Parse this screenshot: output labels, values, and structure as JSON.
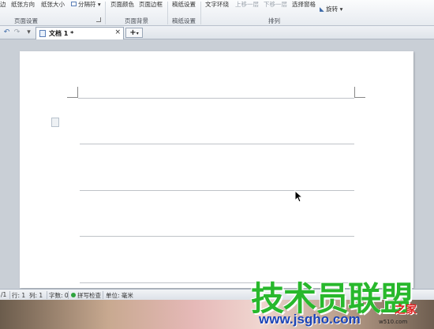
{
  "ribbon": {
    "items": [
      {
        "label": "边",
        "dim": false
      },
      {
        "label": "纸张方向",
        "dim": false
      },
      {
        "label": "纸张大小",
        "dim": false
      },
      {
        "label": "分隔符",
        "dim": false
      },
      {
        "label": "页面颜色",
        "dim": false
      },
      {
        "label": "页面边框",
        "dim": false
      },
      {
        "label": "稿纸设置",
        "dim": false
      },
      {
        "label": "文字环绕",
        "dim": false
      },
      {
        "label": "上移一层",
        "dim": true
      },
      {
        "label": "下移一层",
        "dim": true
      },
      {
        "label": "选择窗格",
        "dim": false
      },
      {
        "label": "旋转",
        "dim": false
      }
    ],
    "groups": [
      "页面设置",
      "页面背景",
      "稿纸设置",
      "排列"
    ]
  },
  "tabbar": {
    "doc_tab_label": "文档 1 *",
    "close_glyph": "×",
    "new_tab_glyph": "+",
    "undo_glyph": "↶",
    "redo_glyph": "↷"
  },
  "status": {
    "page": "/1",
    "line": "行: 1",
    "col": "列: 1",
    "words": "字数: 0",
    "spell": "拼写检查",
    "unit": "单位: 毫米",
    "zoom": "00 %"
  },
  "watermark": {
    "main": "技术员联盟",
    "url": "www.jsgho.com",
    "badge": "之家",
    "small": "w510.com"
  },
  "colors": {
    "watermark_green": "#28b82c",
    "watermark_blue": "#1a44b8",
    "watermark_red": "#e02020"
  }
}
